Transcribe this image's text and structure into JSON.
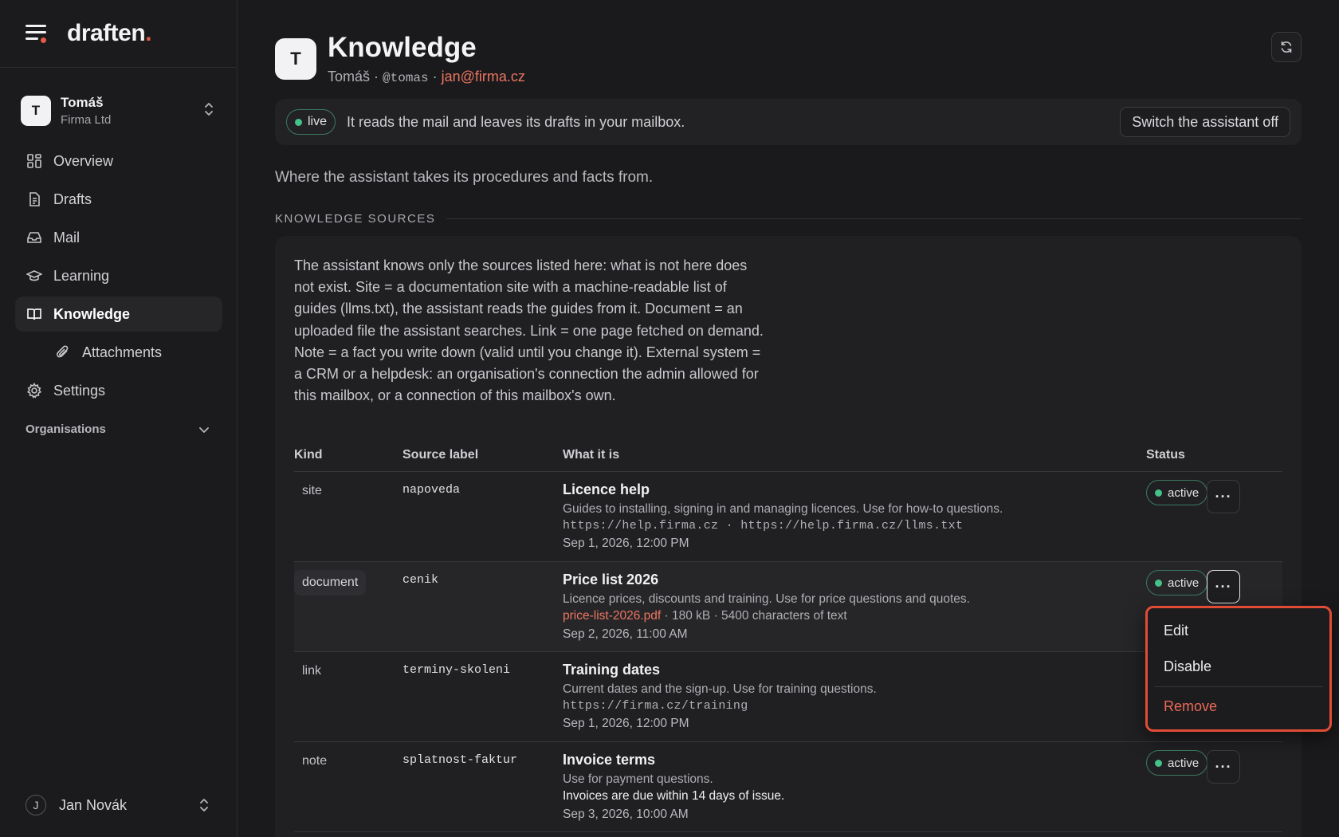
{
  "brand": {
    "name": "draften",
    "period": "."
  },
  "account": {
    "initial": "T",
    "name": "Tomáš",
    "org": "Firma Ltd"
  },
  "nav": {
    "overview": "Overview",
    "drafts": "Drafts",
    "mail": "Mail",
    "learning": "Learning",
    "knowledge": "Knowledge",
    "attachments": "Attachments",
    "settings": "Settings"
  },
  "organisations": "Organisations",
  "user": {
    "initial": "J",
    "name": "Jan Novák"
  },
  "page": {
    "avatar": "T",
    "title": "Knowledge",
    "sub_name": "Tomáš · ",
    "sub_handle": "@tomas",
    "sub_sep": " · ",
    "sub_email": "jan@firma.cz"
  },
  "banner": {
    "status": "live",
    "text": "It reads the mail and leaves its drafts in your mailbox.",
    "button": "Switch the assistant off"
  },
  "intro": "Where the assistant takes its procedures and facts from.",
  "section": "KNOWLEDGE SOURCES",
  "description": "The assistant knows only the sources listed here: what is not here does not exist. Site = a documentation site with a machine-readable list of guides (llms.txt), the assistant reads the guides from it. Document = an uploaded file the assistant searches. Link = one page fetched on demand. Note = a fact you write down (valid until you change it). External system = a CRM or a helpdesk: an organisation's connection the admin allowed for this mailbox, or a connection of this mailbox's own.",
  "table": {
    "headers": {
      "kind": "Kind",
      "label": "Source label",
      "what": "What it is",
      "status": "Status"
    },
    "rows": [
      {
        "kind": "site",
        "label": "napoveda",
        "title": "Licence help",
        "desc": "Guides to installing, signing in and managing licences. Use for how-to questions.",
        "line": "https://help.firma.cz · https://help.firma.cz/llms.txt",
        "date": "Sep 1, 2026, 12:00 PM",
        "status": "active"
      },
      {
        "kind": "document",
        "label": "cenik",
        "title": "Price list 2026",
        "desc": "Licence prices, discounts and training. Use for price questions and quotes.",
        "file": "price-list-2026.pdf",
        "file_meta": " · 180 kB · 5400 characters of text",
        "date": "Sep 2, 2026, 11:00 AM",
        "status": "active"
      },
      {
        "kind": "link",
        "label": "terminy-skoleni",
        "title": "Training dates",
        "desc": "Current dates and the sign-up. Use for training questions.",
        "line": "https://firma.cz/training",
        "date": "Sep 1, 2026, 12:00 PM"
      },
      {
        "kind": "note",
        "label": "splatnost-faktur",
        "title": "Invoice terms",
        "desc": "Use for payment questions.",
        "fact": "Invoices are due within 14 days of issue.",
        "date": "Sep 3, 2026, 10:00 AM",
        "status": "active"
      }
    ],
    "more": "···"
  },
  "menu": {
    "edit": "Edit",
    "disable": "Disable",
    "remove": "Remove"
  },
  "colors": {
    "accent": "#e35b45",
    "status_green": "#45c18a",
    "link": "#ec7560"
  }
}
